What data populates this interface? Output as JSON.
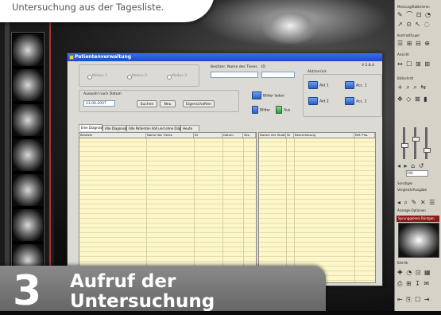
{
  "callout": {
    "text": "Untersuchung aus der Tagesliste."
  },
  "dialog": {
    "title": "Patientenverwaltung",
    "version": "V 2.8.4",
    "search_label": "Besitzer, Name des Tieres",
    "search_id_label": "ID",
    "radios": [
      "Modus 1",
      "Modus 2",
      "Modus 3"
    ],
    "auswahl_label": "Auswahl nach Datum",
    "date_value": "23.06.2007",
    "btn_suchen": "Suchen",
    "btn_neu": "Neu",
    "btn_eigenschaften": "Eigenschaften",
    "btn_bilder_laden": "Bilder laden",
    "btn_bilder": "Bilder",
    "btn_aus": "Aus",
    "akt_header": "Akt/zurück",
    "akt_buttons": [
      "Akt 1",
      "Akt 2",
      "Acc. 1",
      "Acc. 2"
    ],
    "tabs": [
      "Eine Diagnose",
      "Alle Diagnose",
      "Alle Patienten Voll und ohne Diagnose",
      "Heute"
    ],
    "left_columns": [
      "Besitzer",
      "Name des Tieres",
      "ID",
      "Datum",
      "Sex"
    ],
    "right_columns": [
      "Datum der Studie",
      "Nr",
      "Beschreibung",
      "Ref. Pho."
    ]
  },
  "right_panel": {
    "sections": [
      "Messung/Kalibrieren",
      "Kontrast/Lupe",
      "Ansicht",
      "Bildschritt",
      "Sonstiges",
      "Vergleich/Ausgabe",
      "Anzeige-Optionen",
      "Bild-Nr"
    ],
    "zoom_value": "100",
    "thumb_label": "Sprunggelenk Röntgen"
  },
  "banner": {
    "number": "3",
    "title_line1": "Aufruf der",
    "title_line2": "Untersuchung"
  }
}
